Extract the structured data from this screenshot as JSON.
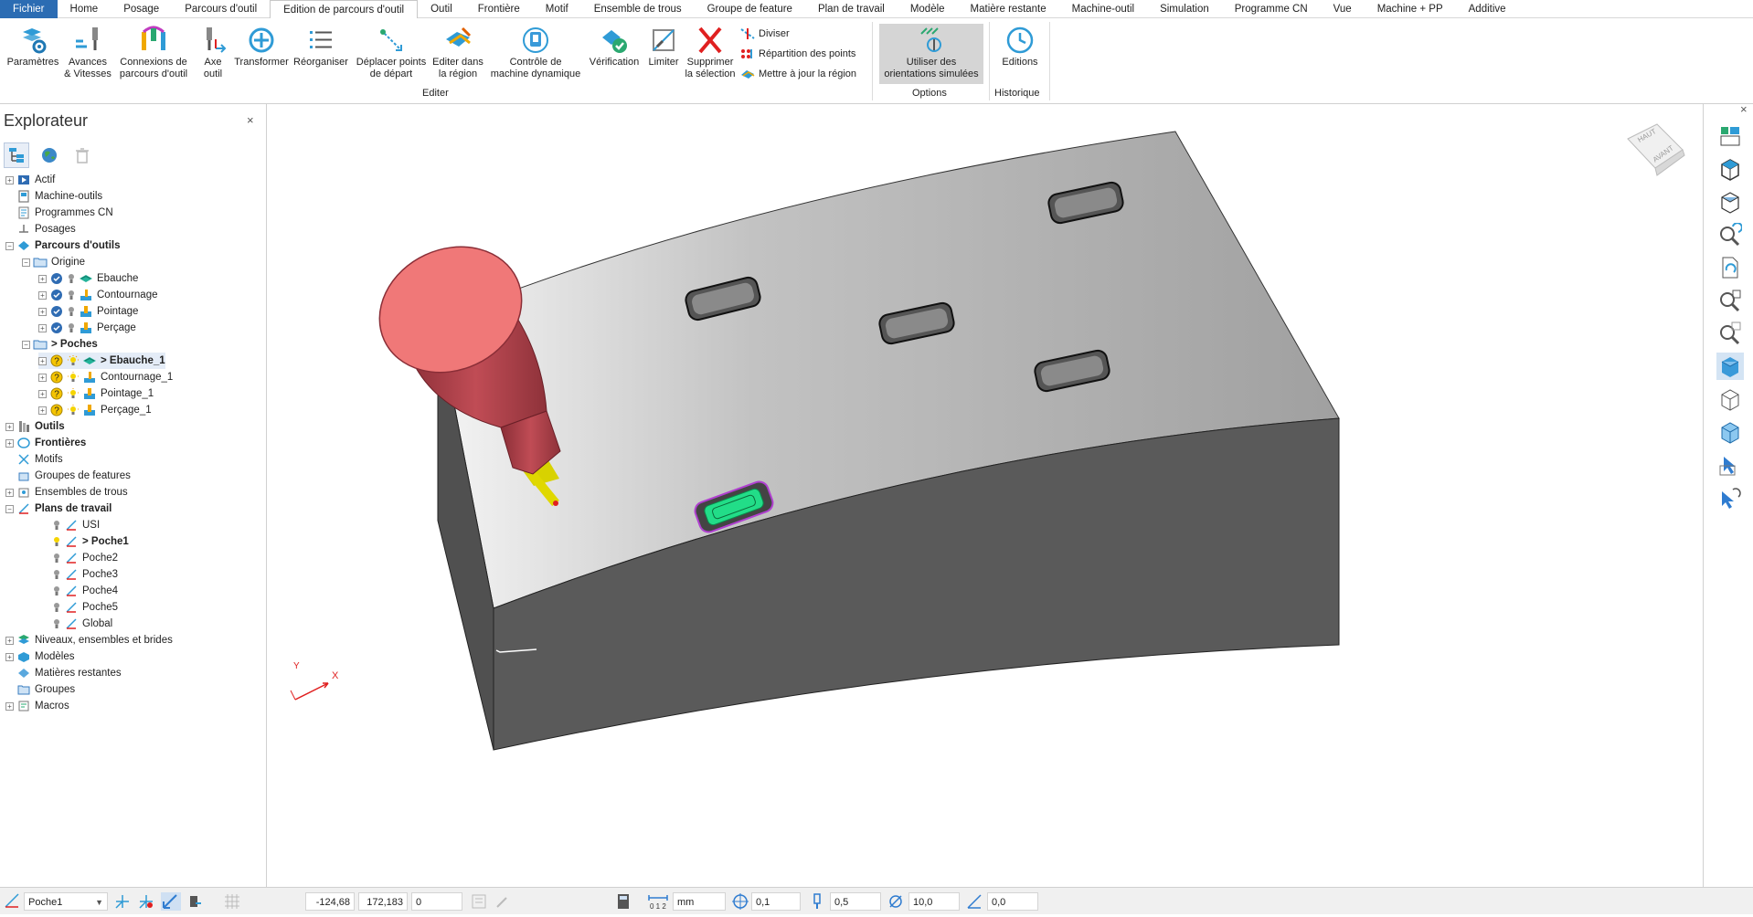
{
  "menu": {
    "tabs": [
      "Fichier",
      "Home",
      "Posage",
      "Parcours d'outil",
      "Edition de parcours d'outil",
      "Outil",
      "Frontière",
      "Motif",
      "Ensemble de trous",
      "Groupe de feature",
      "Plan de travail",
      "Modèle",
      "Matière restante",
      "Machine-outil",
      "Simulation",
      "Programme CN",
      "Vue",
      "Machine + PP",
      "Additive"
    ]
  },
  "ribbon": {
    "parametres": "Paramètres",
    "avances_1": "Avances",
    "avances_2": "& Vitesses",
    "connexions_1": "Connexions de",
    "connexions_2": "parcours d'outil",
    "axe_1": "Axe",
    "axe_2": "outil",
    "transformer": "Transformer",
    "reorganiser": "Réorganiser",
    "deplacer_1": "Déplacer points",
    "deplacer_2": "de départ",
    "editer_region_1": "Editer dans",
    "editer_region_2": "la région",
    "controle_1": "Contrôle de",
    "controle_2": "machine dynamique",
    "verification": "Vérification",
    "limiter": "Limiter",
    "supprimer_1": "Supprimer",
    "supprimer_2": "la sélection",
    "diviser": "Diviser",
    "repartition": "Répartition des points",
    "mettre_a_jour": "Mettre à jour la région",
    "group_editer": "Editer",
    "utiliser_1": "Utiliser des",
    "utiliser_2": "orientations simulées",
    "group_options": "Options",
    "editions": "Editions",
    "group_historique": "Historique"
  },
  "explorer": {
    "title": "Explorateur",
    "close": "×",
    "tree": {
      "actif": "Actif",
      "machine_outils": "Machine-outils",
      "programmes_cn": "Programmes CN",
      "posages": "Posages",
      "parcours": "Parcours d'outils",
      "origine": "Origine",
      "ebauche": "Ebauche",
      "contournage": "Contournage",
      "pointage": "Pointage",
      "percage": "Perçage",
      "poches": "> Poches",
      "ebauche_1": "> Ebauche_1",
      "contournage_1": "Contournage_1",
      "pointage_1": "Pointage_1",
      "percage_1": "Perçage_1",
      "outils": "Outils",
      "frontieres": "Frontières",
      "motifs": "Motifs",
      "groupes_features": "Groupes de features",
      "ensembles_trous": "Ensembles de trous",
      "plans": "Plans de travail",
      "usi": "USI",
      "poche1": "> Poche1",
      "poche2": "Poche2",
      "poche3": "Poche3",
      "poche4": "Poche4",
      "poche5": "Poche5",
      "global": "Global",
      "niveaux": "Niveaux, ensembles et brides",
      "modeles": "Modèles",
      "matieres": "Matières restantes",
      "groupes": "Groupes",
      "macros": "Macros"
    }
  },
  "viewcube": {
    "top": "HAUT",
    "front": "AVANT"
  },
  "axes": {
    "x": "X",
    "y": "Y"
  },
  "viewport": {
    "close": "×"
  },
  "status": {
    "workplane": "Poche1",
    "x": "-124,68",
    "y": "172,183",
    "z": "0",
    "units": "mm",
    "tolerance": "0,1",
    "stepover": "0,5",
    "diameter": "10,0",
    "angle": "0,0"
  },
  "colors": {
    "brand": "#2b6cb3",
    "tool_body": "#b8474f",
    "tool_top": "#f07878",
    "shank": "#d9d200",
    "part_top": "#ababab",
    "part_side": "#5a5a5a"
  }
}
